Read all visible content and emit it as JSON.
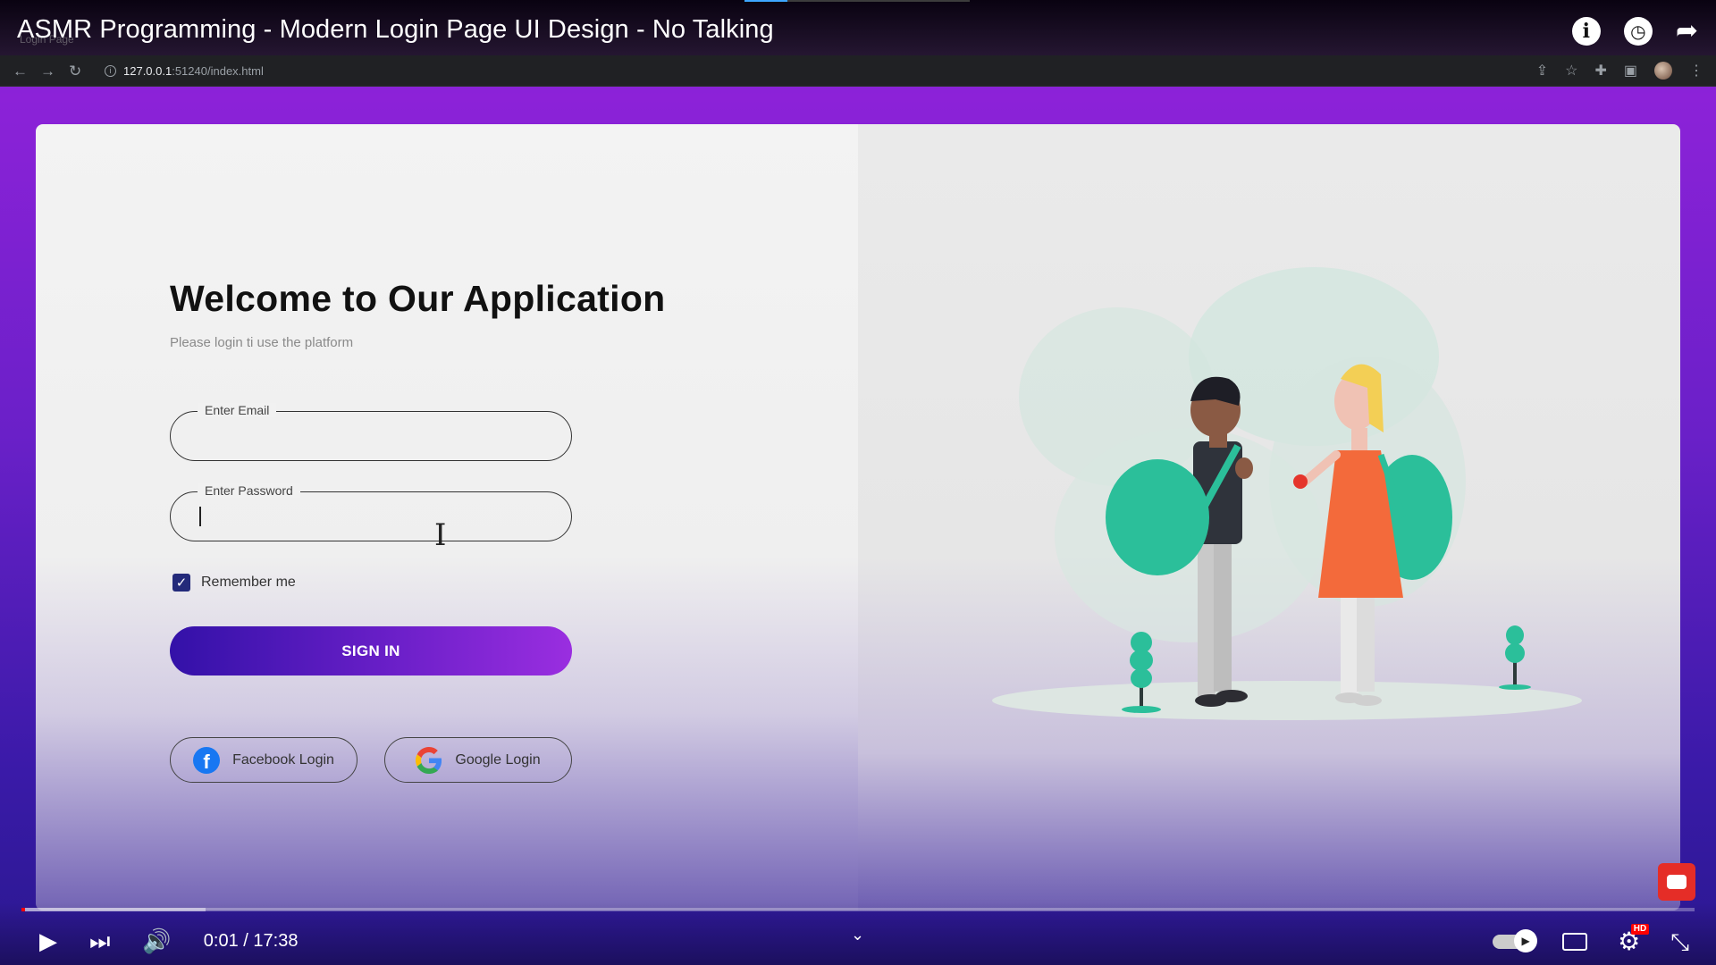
{
  "video": {
    "title": "ASMR Programming - Modern Login Page UI Design - No Talking",
    "tab_hint": "Login Page",
    "elapsed": "0:01",
    "separator": " / ",
    "duration": "17:38",
    "played_fraction": 0.001,
    "loaded_fraction": 0.11
  },
  "browser": {
    "url_host": "127.0.0.1",
    "url_path": ":51240/index.html"
  },
  "login": {
    "heading": "Welcome to Our Application",
    "subtitle": "Please login ti use the platform",
    "email_label": "Enter Email",
    "email_value": "",
    "password_label": "Enter Password",
    "password_value": "",
    "remember_label": "Remember me",
    "remember_checked": true,
    "signin_label": "SIGN IN",
    "facebook_label": "Facebook Login",
    "google_label": "Google Login"
  },
  "colors": {
    "accent_start": "#3311a8",
    "accent_end": "#9a2ee0",
    "checkbox": "#232a7a",
    "facebook": "#1877f2",
    "youtube_red": "#ff0000"
  }
}
